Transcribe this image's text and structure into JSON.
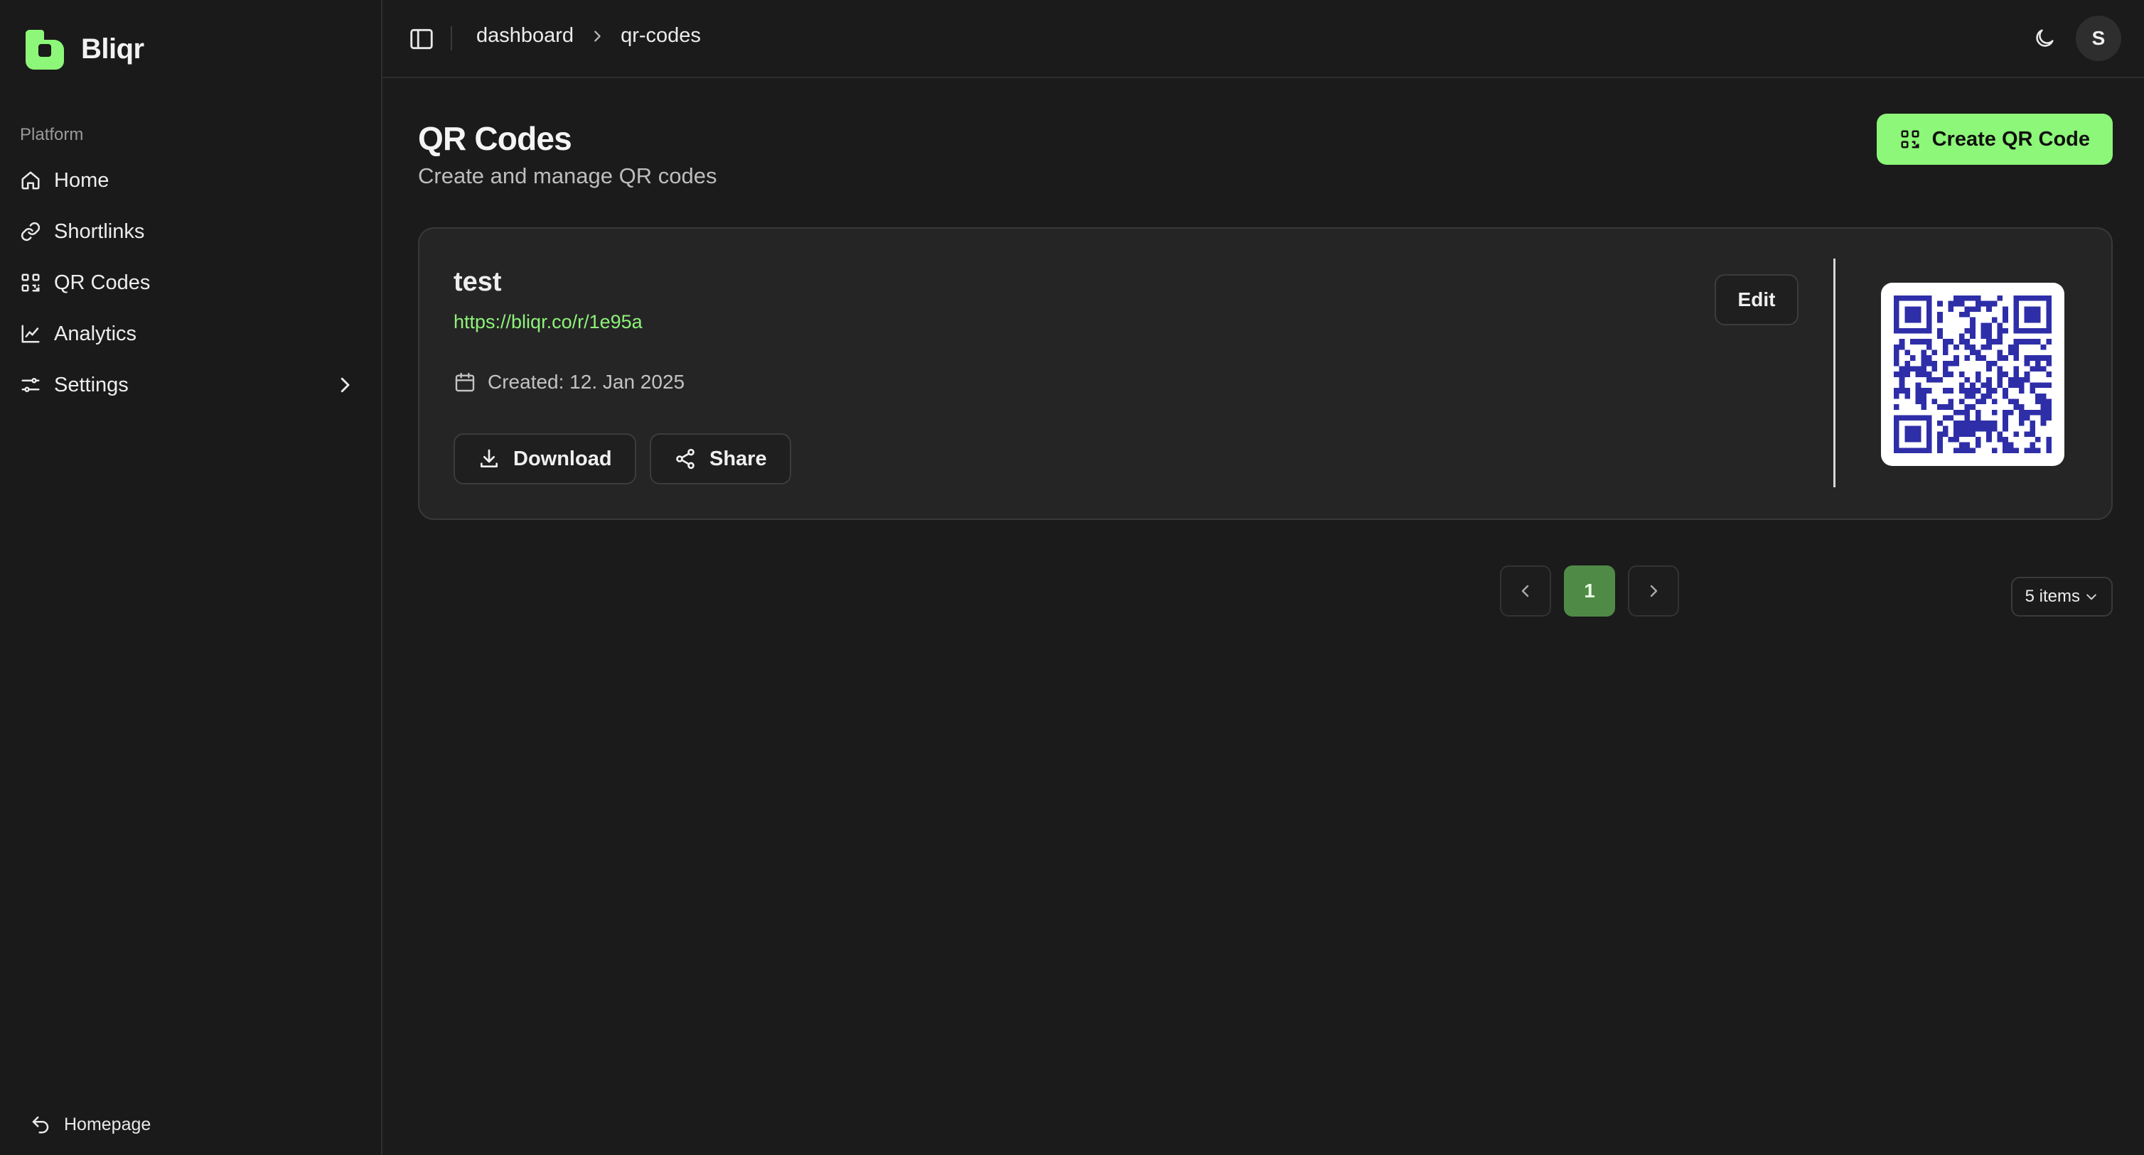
{
  "app": {
    "name": "Bliqr",
    "brand_color": "#8cf778"
  },
  "sidebar": {
    "section_label": "Platform",
    "items": [
      {
        "label": "Home",
        "icon": "home-icon"
      },
      {
        "label": "Shortlinks",
        "icon": "link-icon"
      },
      {
        "label": "QR Codes",
        "icon": "qr-icon"
      },
      {
        "label": "Analytics",
        "icon": "chart-icon"
      },
      {
        "label": "Settings",
        "icon": "sliders-icon"
      }
    ],
    "footer_link": "Homepage"
  },
  "topbar": {
    "breadcrumb": [
      "dashboard",
      "qr-codes"
    ],
    "avatar_initial": "S"
  },
  "page": {
    "title": "QR Codes",
    "subtitle": "Create and manage QR codes",
    "create_button": "Create QR Code"
  },
  "qr_cards": [
    {
      "title": "test",
      "url": "https://bliqr.co/r/1e95a",
      "created": "Created: 12. Jan 2025",
      "edit_label": "Edit",
      "download_label": "Download",
      "share_label": "Share",
      "qr_color": "#2e2ea8"
    }
  ],
  "pagination": {
    "pages": [
      "1"
    ],
    "current": "1",
    "page_size": "5 items"
  }
}
